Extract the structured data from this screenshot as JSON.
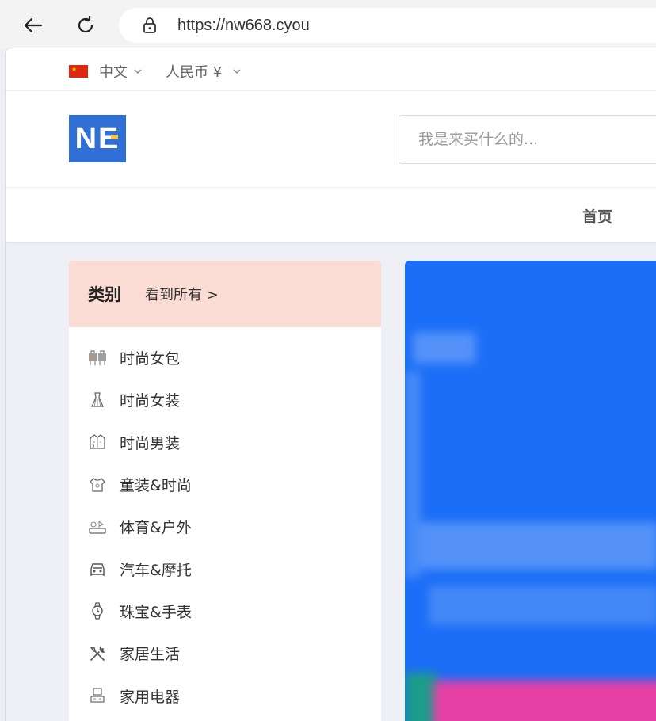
{
  "browser": {
    "url": "https://nw668.cyou"
  },
  "topbar": {
    "language": "中文",
    "currency": "人民币 ¥"
  },
  "header": {
    "logo_text": "NE",
    "search_placeholder": "我是来买什么的..."
  },
  "nav": {
    "home": "首页"
  },
  "categories": {
    "title": "类别",
    "view_all": "看到所有 >",
    "items": [
      {
        "label": "时尚女包",
        "icon": "handbag-icon"
      },
      {
        "label": "时尚女装",
        "icon": "dress-icon"
      },
      {
        "label": "时尚男装",
        "icon": "jacket-icon"
      },
      {
        "label": "童装&时尚",
        "icon": "kids-shirt-icon"
      },
      {
        "label": "体育&户外",
        "icon": "sports-icon"
      },
      {
        "label": "汽车&摩托",
        "icon": "car-icon"
      },
      {
        "label": "珠宝&手表",
        "icon": "watch-icon"
      },
      {
        "label": "家居生活",
        "icon": "tools-icon"
      },
      {
        "label": "家用电器",
        "icon": "appliance-icon"
      }
    ]
  },
  "colors": {
    "accent": "#2f6fd6",
    "category_header": "#fbdcd5",
    "banner": "#1b6ef7"
  }
}
